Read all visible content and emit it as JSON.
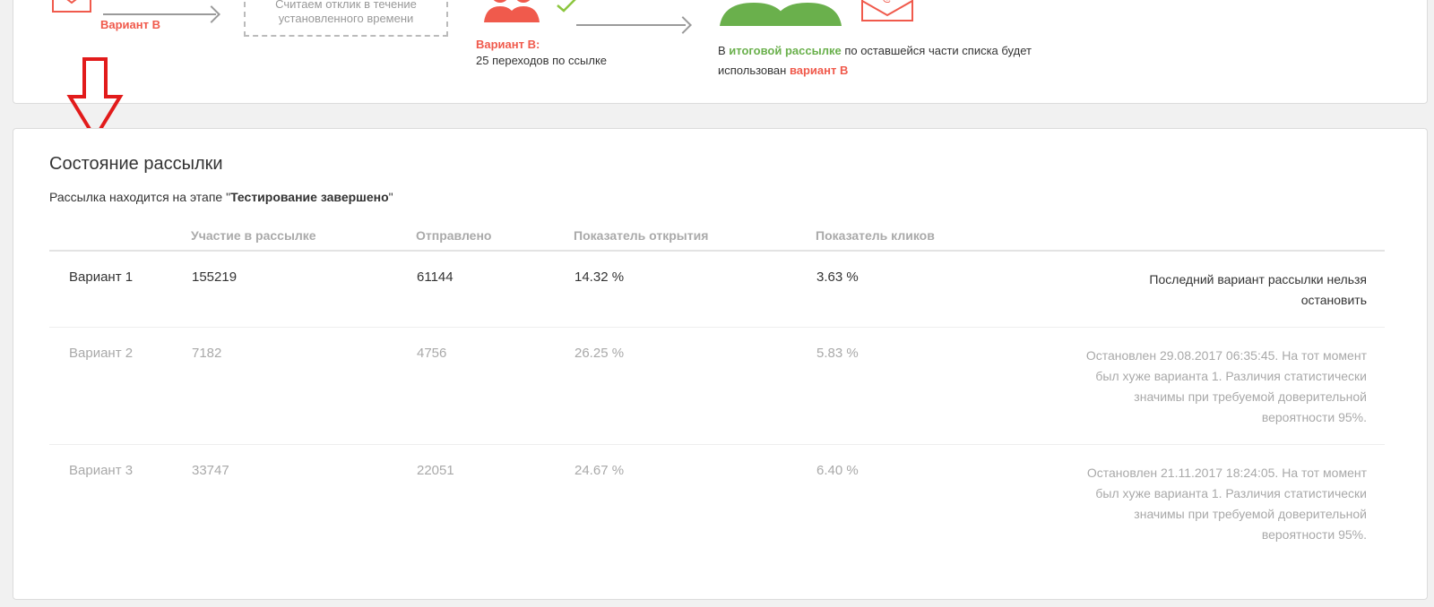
{
  "flow": {
    "variant_b_label": "Вариант В",
    "waiting_box": "Считаем отклик в течение установленного времени",
    "result_title": "Вариант В:",
    "result_text": "25 переходов по ссылке",
    "final_prefix": "В ",
    "final_highlight": "итоговой рассылке",
    "final_middle": " по оставшейся части списка будет использован ",
    "final_variant": "вариант В",
    "colors": {
      "red": "#f05a4c",
      "green": "#6ab04c"
    }
  },
  "status": {
    "title": "Состояние рассылки",
    "stage_prefix": "Рассылка находится на этапе \"",
    "stage_name": "Тестирование завершено",
    "stage_suffix": "\""
  },
  "table": {
    "headers": [
      "",
      "Участие в рассылке",
      "Отправлено",
      "Показатель открытия",
      "Показатель кликов",
      ""
    ],
    "rows": [
      {
        "variant": "Вариант 1",
        "participants": "155219",
        "sent": "61144",
        "open_rate": "14.32 %",
        "click_rate": "3.63 %",
        "note": "Последний вариант рассылки нельзя остановить"
      },
      {
        "variant": "Вариант 2",
        "participants": "7182",
        "sent": "4756",
        "open_rate": "26.25 %",
        "click_rate": "5.83 %",
        "note": "Остановлен 29.08.2017 06:35:45. На тот момент был хуже варианта 1. Различия статистически значимы при требуемой доверительной вероятности 95%."
      },
      {
        "variant": "Вариант 3",
        "participants": "33747",
        "sent": "22051",
        "open_rate": "24.67 %",
        "click_rate": "6.40 %",
        "note": "Остановлен 21.11.2017 18:24:05. На тот момент был хуже варианта 1. Различия статистически значимы при требуемой доверительной вероятности 95%."
      }
    ]
  }
}
